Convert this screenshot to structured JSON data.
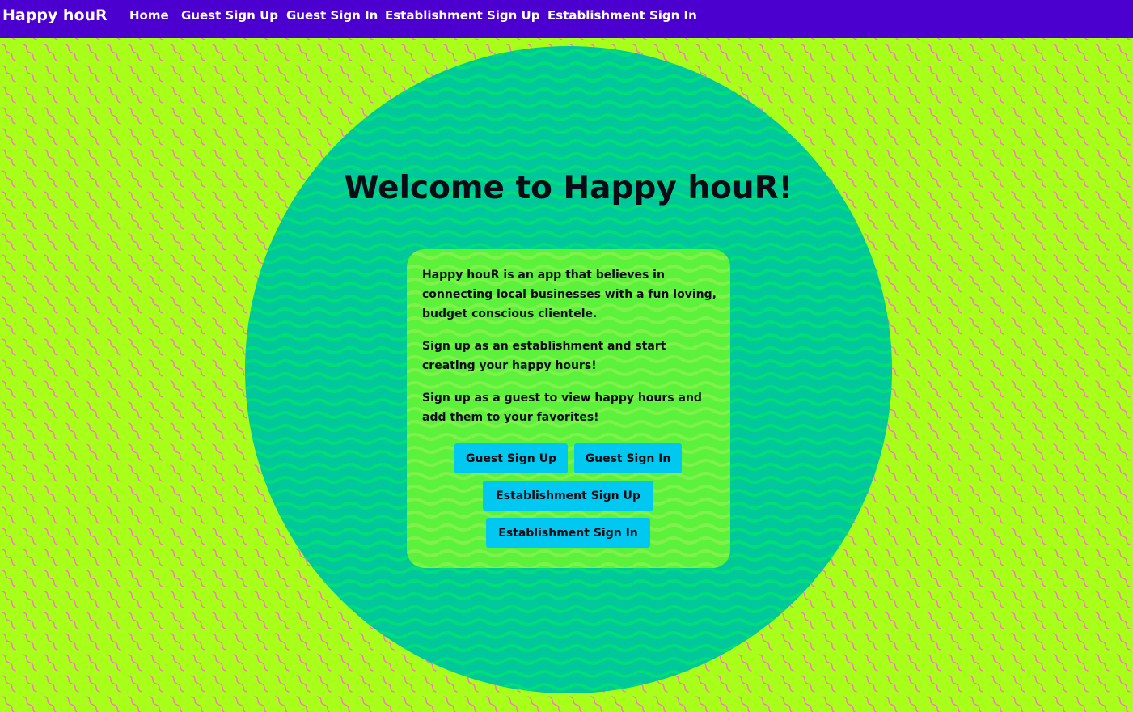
{
  "nav": {
    "brand": "Happy houR",
    "links": [
      {
        "label": "Home"
      },
      {
        "label": "Guest Sign Up"
      },
      {
        "label": "Guest Sign In"
      },
      {
        "label": "Establishment Sign Up"
      },
      {
        "label": "Establishment Sign In"
      }
    ]
  },
  "main": {
    "title": "Welcome to Happy houR!",
    "paragraphs": [
      "Happy houR is an app that believes in connecting local businesses with a fun loving, budget conscious clientele.",
      "Sign up as an establishment and start creating your happy hours!",
      "Sign up as a guest to view happy hours and add them to your favorites!"
    ],
    "buttons": {
      "guest_sign_up": "Guest Sign Up",
      "guest_sign_in": "Guest Sign In",
      "establishment_sign_up": "Establishment Sign Up",
      "establishment_sign_in": "Establishment Sign In"
    }
  },
  "colors": {
    "navbar": "#4c00d0",
    "page_background": "#a8ff1a",
    "squiggle_pattern": "#ff6ec7",
    "circle": "#00c89a",
    "circle_waves": "#00dd7a",
    "card": "#5cf23c",
    "button": "#00c8f0",
    "text": "#0c0c14"
  }
}
